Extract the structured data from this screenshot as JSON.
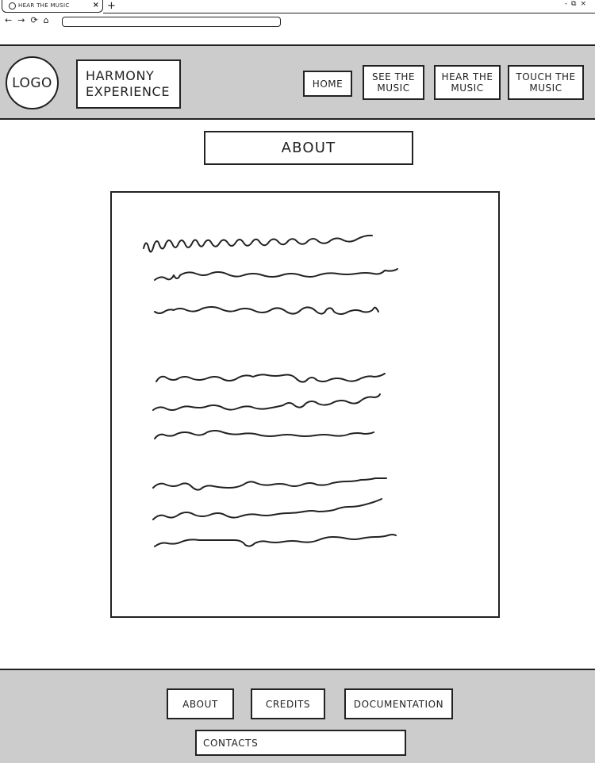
{
  "browser": {
    "tab_title": "HEAR THE MUSIC",
    "tab_close": "×",
    "new_tab": "+",
    "nav_icons": {
      "back": "←",
      "forward": "→",
      "reload": "⟳",
      "home": "⌂"
    },
    "window_controls": {
      "minimize": "-",
      "restore": "⧉",
      "close": "×"
    }
  },
  "header": {
    "logo": "LOGO",
    "site_name_line1": "HARMONY",
    "site_name_line2": "EXPERIENCE",
    "nav": [
      {
        "line1": "HOME",
        "line2": ""
      },
      {
        "line1": "SEE THE",
        "line2": "MUSIC"
      },
      {
        "line1": "HEAR THE",
        "line2": "MUSIC"
      },
      {
        "line1": "TOUCH THE",
        "line2": "MUSIC"
      }
    ]
  },
  "main": {
    "section_title": "ABOUT",
    "content_placeholder_icon": "scribble-text-placeholder"
  },
  "footer": {
    "links": [
      "ABOUT",
      "CREDITS",
      "DOCUMENTATION",
      "CONTACTS"
    ]
  },
  "colors": {
    "band_gray": "#cccccc",
    "line": "#222222",
    "background": "#ffffff"
  }
}
